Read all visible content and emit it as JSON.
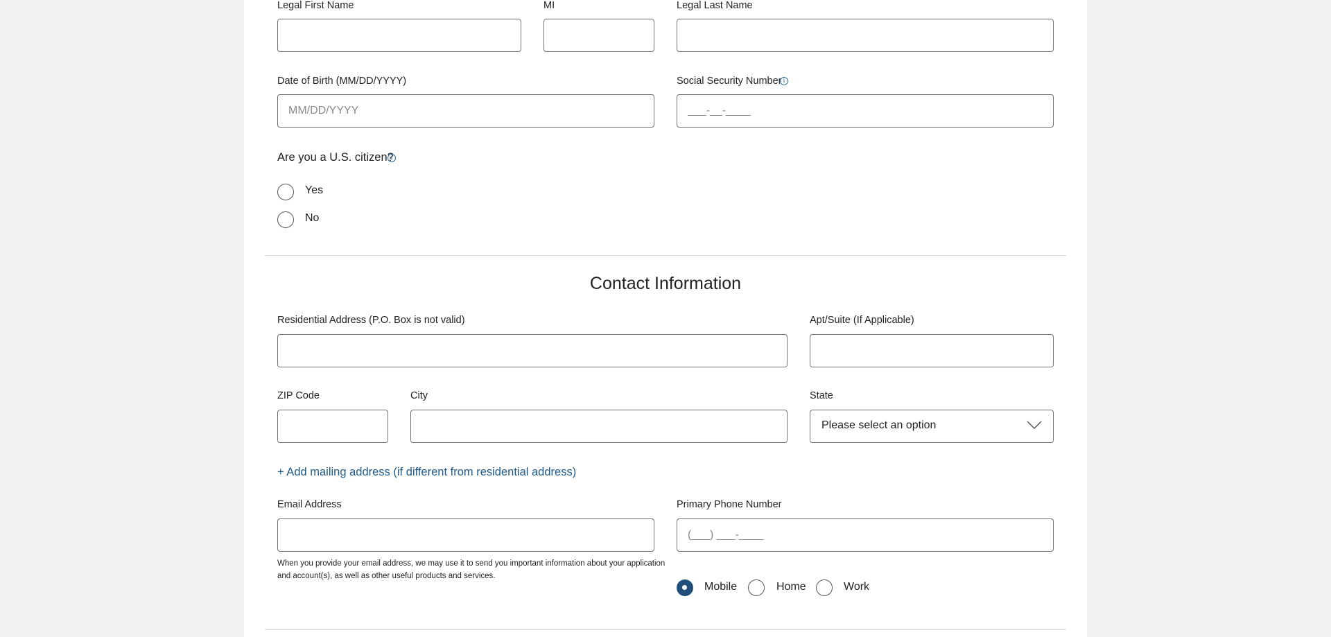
{
  "personal": {
    "first_name_label": "Legal First Name",
    "mi_label": "MI",
    "last_name_label": "Legal Last Name",
    "dob_label": "Date of Birth (MM/DD/YYYY)",
    "dob_placeholder": "MM/DD/YYYY",
    "ssn_label": "Social Security Number",
    "ssn_placeholder": "___-__-____",
    "citizen_question": "Are you a U.S. citizen?",
    "citizen_options": [
      "Yes",
      "No"
    ],
    "info_icon": "info-icon"
  },
  "contact": {
    "title": "Contact Information",
    "address_label": "Residential Address (P.O. Box is not valid)",
    "apt_label": "Apt/Suite (If Applicable)",
    "zip_label": "ZIP Code",
    "city_label": "City",
    "state_label": "State",
    "state_value": "Please select an option",
    "mailing_link": "+ Add mailing address (if different from residential address)",
    "email_label": "Email Address",
    "email_help": "When you provide your email address, we may use it to send you important information about your application and account(s), as well as other useful products and services.",
    "phone_label": "Primary Phone Number",
    "phone_placeholder": "(___) ___-____",
    "phone_types": [
      "Mobile",
      "Home",
      "Work"
    ],
    "phone_type_selected": "Mobile"
  },
  "colors": {
    "accent": "#1f4f7a",
    "link": "#1f5b8a",
    "page_bg": "#f2f2f2",
    "card_bg": "#ffffff",
    "border": "#6f6f6f"
  }
}
